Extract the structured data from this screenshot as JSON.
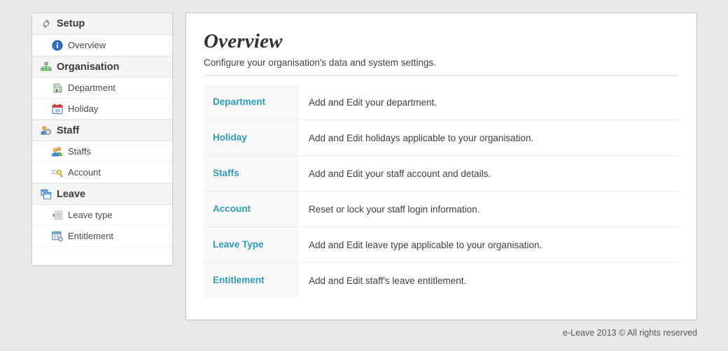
{
  "sidebar": {
    "groups": [
      {
        "label": "Setup",
        "icon": "gear-icon",
        "items": [
          {
            "label": "Overview",
            "icon": "info-circle-icon"
          }
        ]
      },
      {
        "label": "Organisation",
        "icon": "org-chart-icon",
        "items": [
          {
            "label": "Department",
            "icon": "building-icon"
          },
          {
            "label": "Holiday",
            "icon": "calendar-icon"
          }
        ]
      },
      {
        "label": "Staff",
        "icon": "users-gear-icon",
        "items": [
          {
            "label": "Staffs",
            "icon": "users-icon"
          },
          {
            "label": "Account",
            "icon": "key-icon"
          }
        ]
      },
      {
        "label": "Leave",
        "icon": "windows-stack-icon",
        "items": [
          {
            "label": "Leave type",
            "icon": "list-icon"
          },
          {
            "label": "Entitlement",
            "icon": "table-gear-icon"
          }
        ]
      }
    ]
  },
  "main": {
    "title": "Overview",
    "subtitle": "Configure your organisation's data and system settings.",
    "rows": [
      {
        "link": "Department",
        "description": "Add and Edit your department."
      },
      {
        "link": "Holiday",
        "description": "Add and Edit holidays applicable to your organisation."
      },
      {
        "link": "Staffs",
        "description": "Add and Edit your staff account and details."
      },
      {
        "link": "Account",
        "description": "Reset or lock your staff login information."
      },
      {
        "link": "Leave Type",
        "description": "Add and Edit leave type applicable to your organisation."
      },
      {
        "link": "Entitlement",
        "description": "Add and Edit staff's leave entitlement."
      }
    ]
  },
  "footer": {
    "text": "e-Leave 2013 © All rights reserved"
  },
  "colors": {
    "page_background": "#e9e9e9",
    "panel_background": "#ffffff",
    "link_accent": "#2f9cb3",
    "section_header_background": "#f5f5f5",
    "table_link_column_background": "#f8f8f8",
    "title_text": "#333333"
  }
}
